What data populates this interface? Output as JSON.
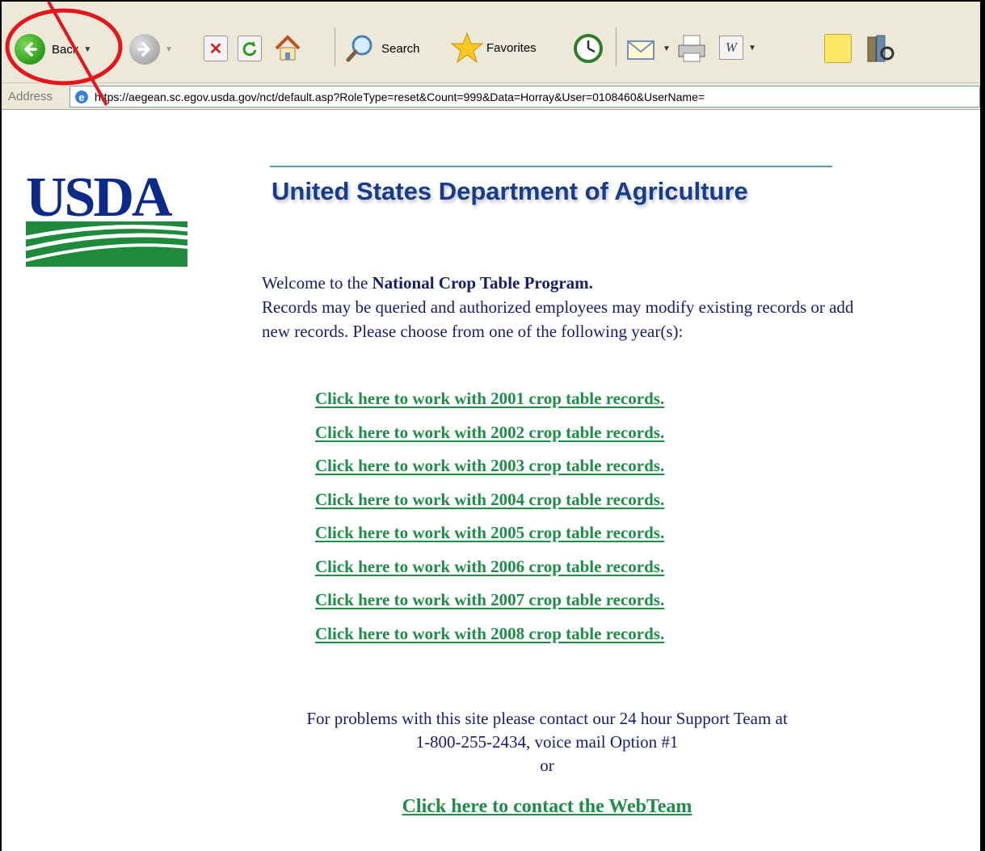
{
  "toolbar": {
    "back_label": "Back",
    "search_label": "Search",
    "favorites_label": "Favorites"
  },
  "address": {
    "label": "Address",
    "url": "https://aegean.sc.egov.usda.gov/nct/default.asp?RoleType=reset&Count=999&Data=Horray&User=0108460&UserName="
  },
  "page": {
    "logo_text": "USDA",
    "title": "United States Department of Agriculture",
    "welcome_prefix": "Welcome to the ",
    "program_name": "National Crop Table Program.",
    "welcome_text": "Records may be queried and authorized employees may modify existing records or add new records. Please choose from one of the following year(s):",
    "year_links": [
      "Click here to work with 2001 crop table records.",
      "Click here to work with 2002 crop table records.",
      "Click here to work with 2003 crop table records.",
      "Click here to work with 2004 crop table records.",
      "Click here to work with 2005 crop table records.",
      "Click here to work with 2006 crop table records.",
      "Click here to work with 2007 crop table records.",
      "Click here to work with 2008 crop table records."
    ],
    "support_line1": "For problems with this site please contact our 24 hour Support Team at",
    "support_line2": "1-800-255-2434, voice mail Option #1",
    "support_or": "or",
    "webteam_link": "Click here to contact the WebTeam"
  },
  "colors": {
    "link_green": "#1f8c48",
    "text_navy": "#1a1a6e",
    "annotation_red": "#e8141c"
  }
}
